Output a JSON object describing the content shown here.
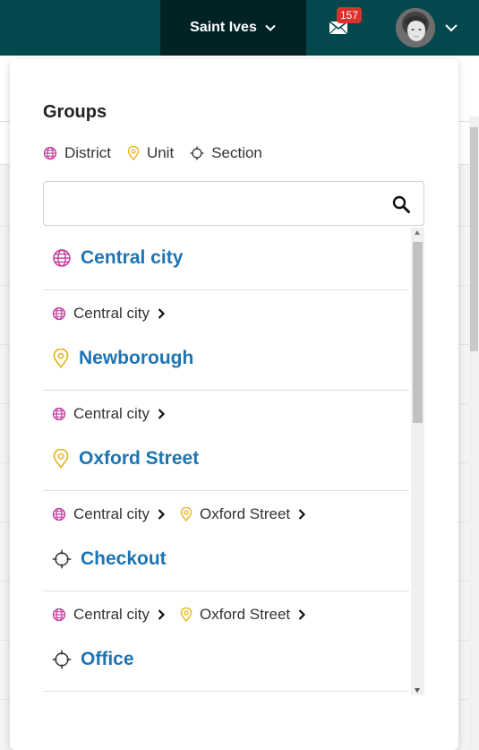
{
  "topbar": {
    "org_name": "Saint Ives",
    "unread_count": "157",
    "brand_color": "#03484c"
  },
  "panel": {
    "title": "Groups",
    "legend": [
      {
        "icon": "globe-icon",
        "label": "District"
      },
      {
        "icon": "pin-icon",
        "label": "Unit"
      },
      {
        "icon": "crosshair-icon",
        "label": "Section"
      }
    ],
    "search": {
      "value": "",
      "placeholder": ""
    },
    "results": [
      {
        "name": "Central city",
        "type": "District",
        "path": []
      },
      {
        "name": "Newborough",
        "type": "Unit",
        "path": [
          {
            "label": "Central city",
            "type": "District"
          }
        ]
      },
      {
        "name": "Oxford Street",
        "type": "Unit",
        "path": [
          {
            "label": "Central city",
            "type": "District"
          }
        ]
      },
      {
        "name": "Checkout",
        "type": "Section",
        "path": [
          {
            "label": "Central city",
            "type": "District"
          },
          {
            "label": "Oxford Street",
            "type": "Unit"
          }
        ]
      },
      {
        "name": "Office",
        "type": "Section",
        "path": [
          {
            "label": "Central city",
            "type": "District"
          },
          {
            "label": "Oxford Street",
            "type": "Unit"
          }
        ]
      }
    ]
  },
  "colors": {
    "district": "#c0399b",
    "unit": "#e8b21d",
    "section": "#333333",
    "link": "#1d74b3"
  }
}
